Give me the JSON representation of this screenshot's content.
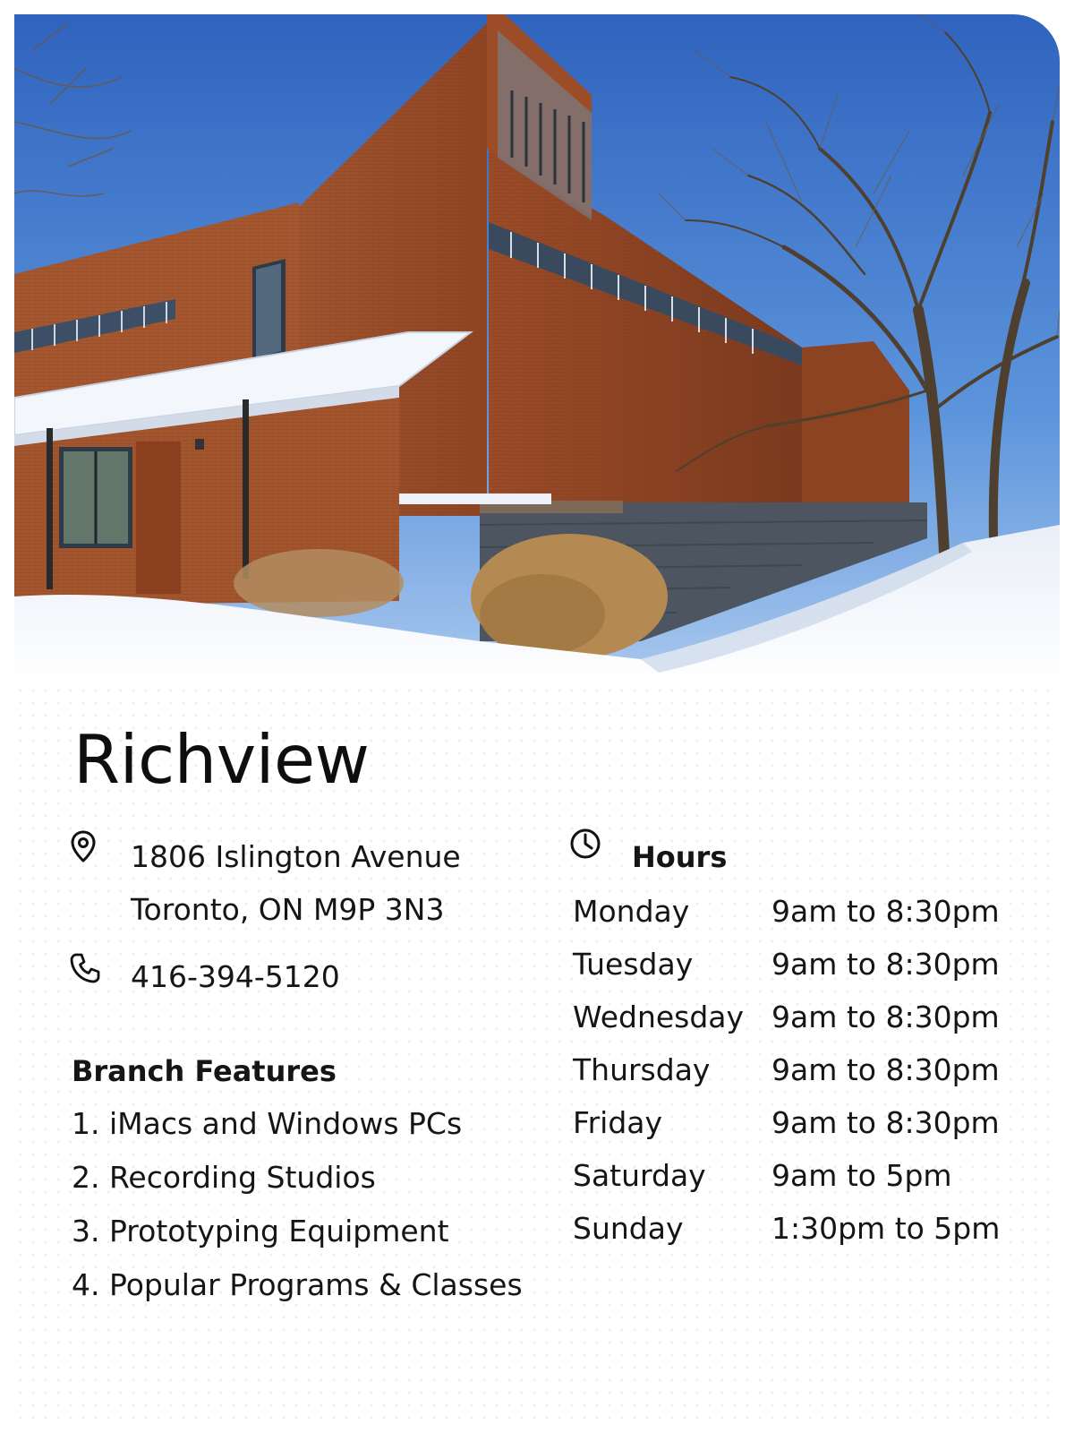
{
  "branch": {
    "name": "Richview",
    "address_line1": "1806 Islington Avenue",
    "address_line2": "Toronto, ON  M9P 3N3",
    "phone": "416-394-5120"
  },
  "features": {
    "heading": "Branch Features",
    "items": [
      "1. iMacs and Windows PCs",
      "2. Recording Studios",
      "3. Prototyping Equipment",
      "4. Popular Programs & Classes"
    ]
  },
  "hours": {
    "heading": "Hours",
    "rows": [
      {
        "day": "Monday",
        "time": "9am to 8:30pm"
      },
      {
        "day": "Tuesday",
        "time": "9am to 8:30pm"
      },
      {
        "day": "Wednesday",
        "time": "9am to 8:30pm"
      },
      {
        "day": "Thursday",
        "time": "9am to 8:30pm"
      },
      {
        "day": "Friday",
        "time": "9am to 8:30pm"
      },
      {
        "day": "Saturday",
        "time": "9am to 5pm"
      },
      {
        "day": "Sunday",
        "time": "1:30pm to 5pm"
      }
    ]
  },
  "icons": {
    "location": "map-pin-icon",
    "phone": "phone-icon",
    "hours": "clock-icon"
  },
  "colors": {
    "text": "#151515",
    "sky": "#3b73c9",
    "brick": "#a2522c",
    "snow": "#f4f7fb"
  }
}
